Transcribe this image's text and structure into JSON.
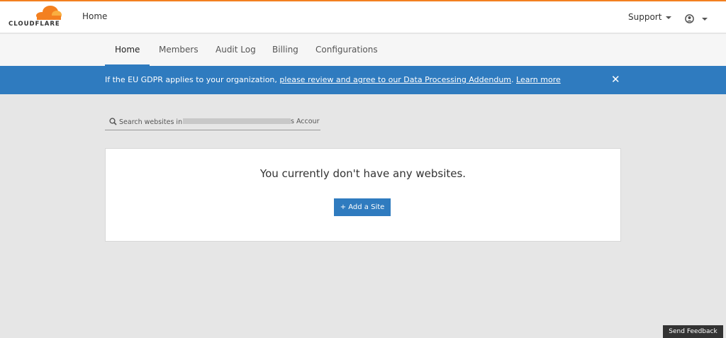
{
  "header": {
    "logo_text": "CLOUDFLARE",
    "home_label": "Home",
    "support_label": "Support"
  },
  "nav": {
    "tabs": [
      {
        "label": "Home",
        "active": true
      },
      {
        "label": "Members"
      },
      {
        "label": "Audit Log"
      },
      {
        "label": "Billing"
      },
      {
        "label": "Configurations"
      }
    ]
  },
  "banner": {
    "text_prefix": "If the EU GDPR applies to your organization, ",
    "review_link": "please review and agree to our Data Processing Addendum",
    "separator": ". ",
    "learn_more": "Learn more",
    "close_glyph": "✕"
  },
  "search": {
    "placeholder": "Search websites in",
    "tail": "s Accour"
  },
  "main": {
    "empty_message": "You currently don't have any websites.",
    "add_site_label": "+ Add a Site"
  },
  "feedback_label": "Send Feedback",
  "colors": {
    "brand_orange": "#f38020",
    "accent_blue": "#2f7bbf"
  }
}
